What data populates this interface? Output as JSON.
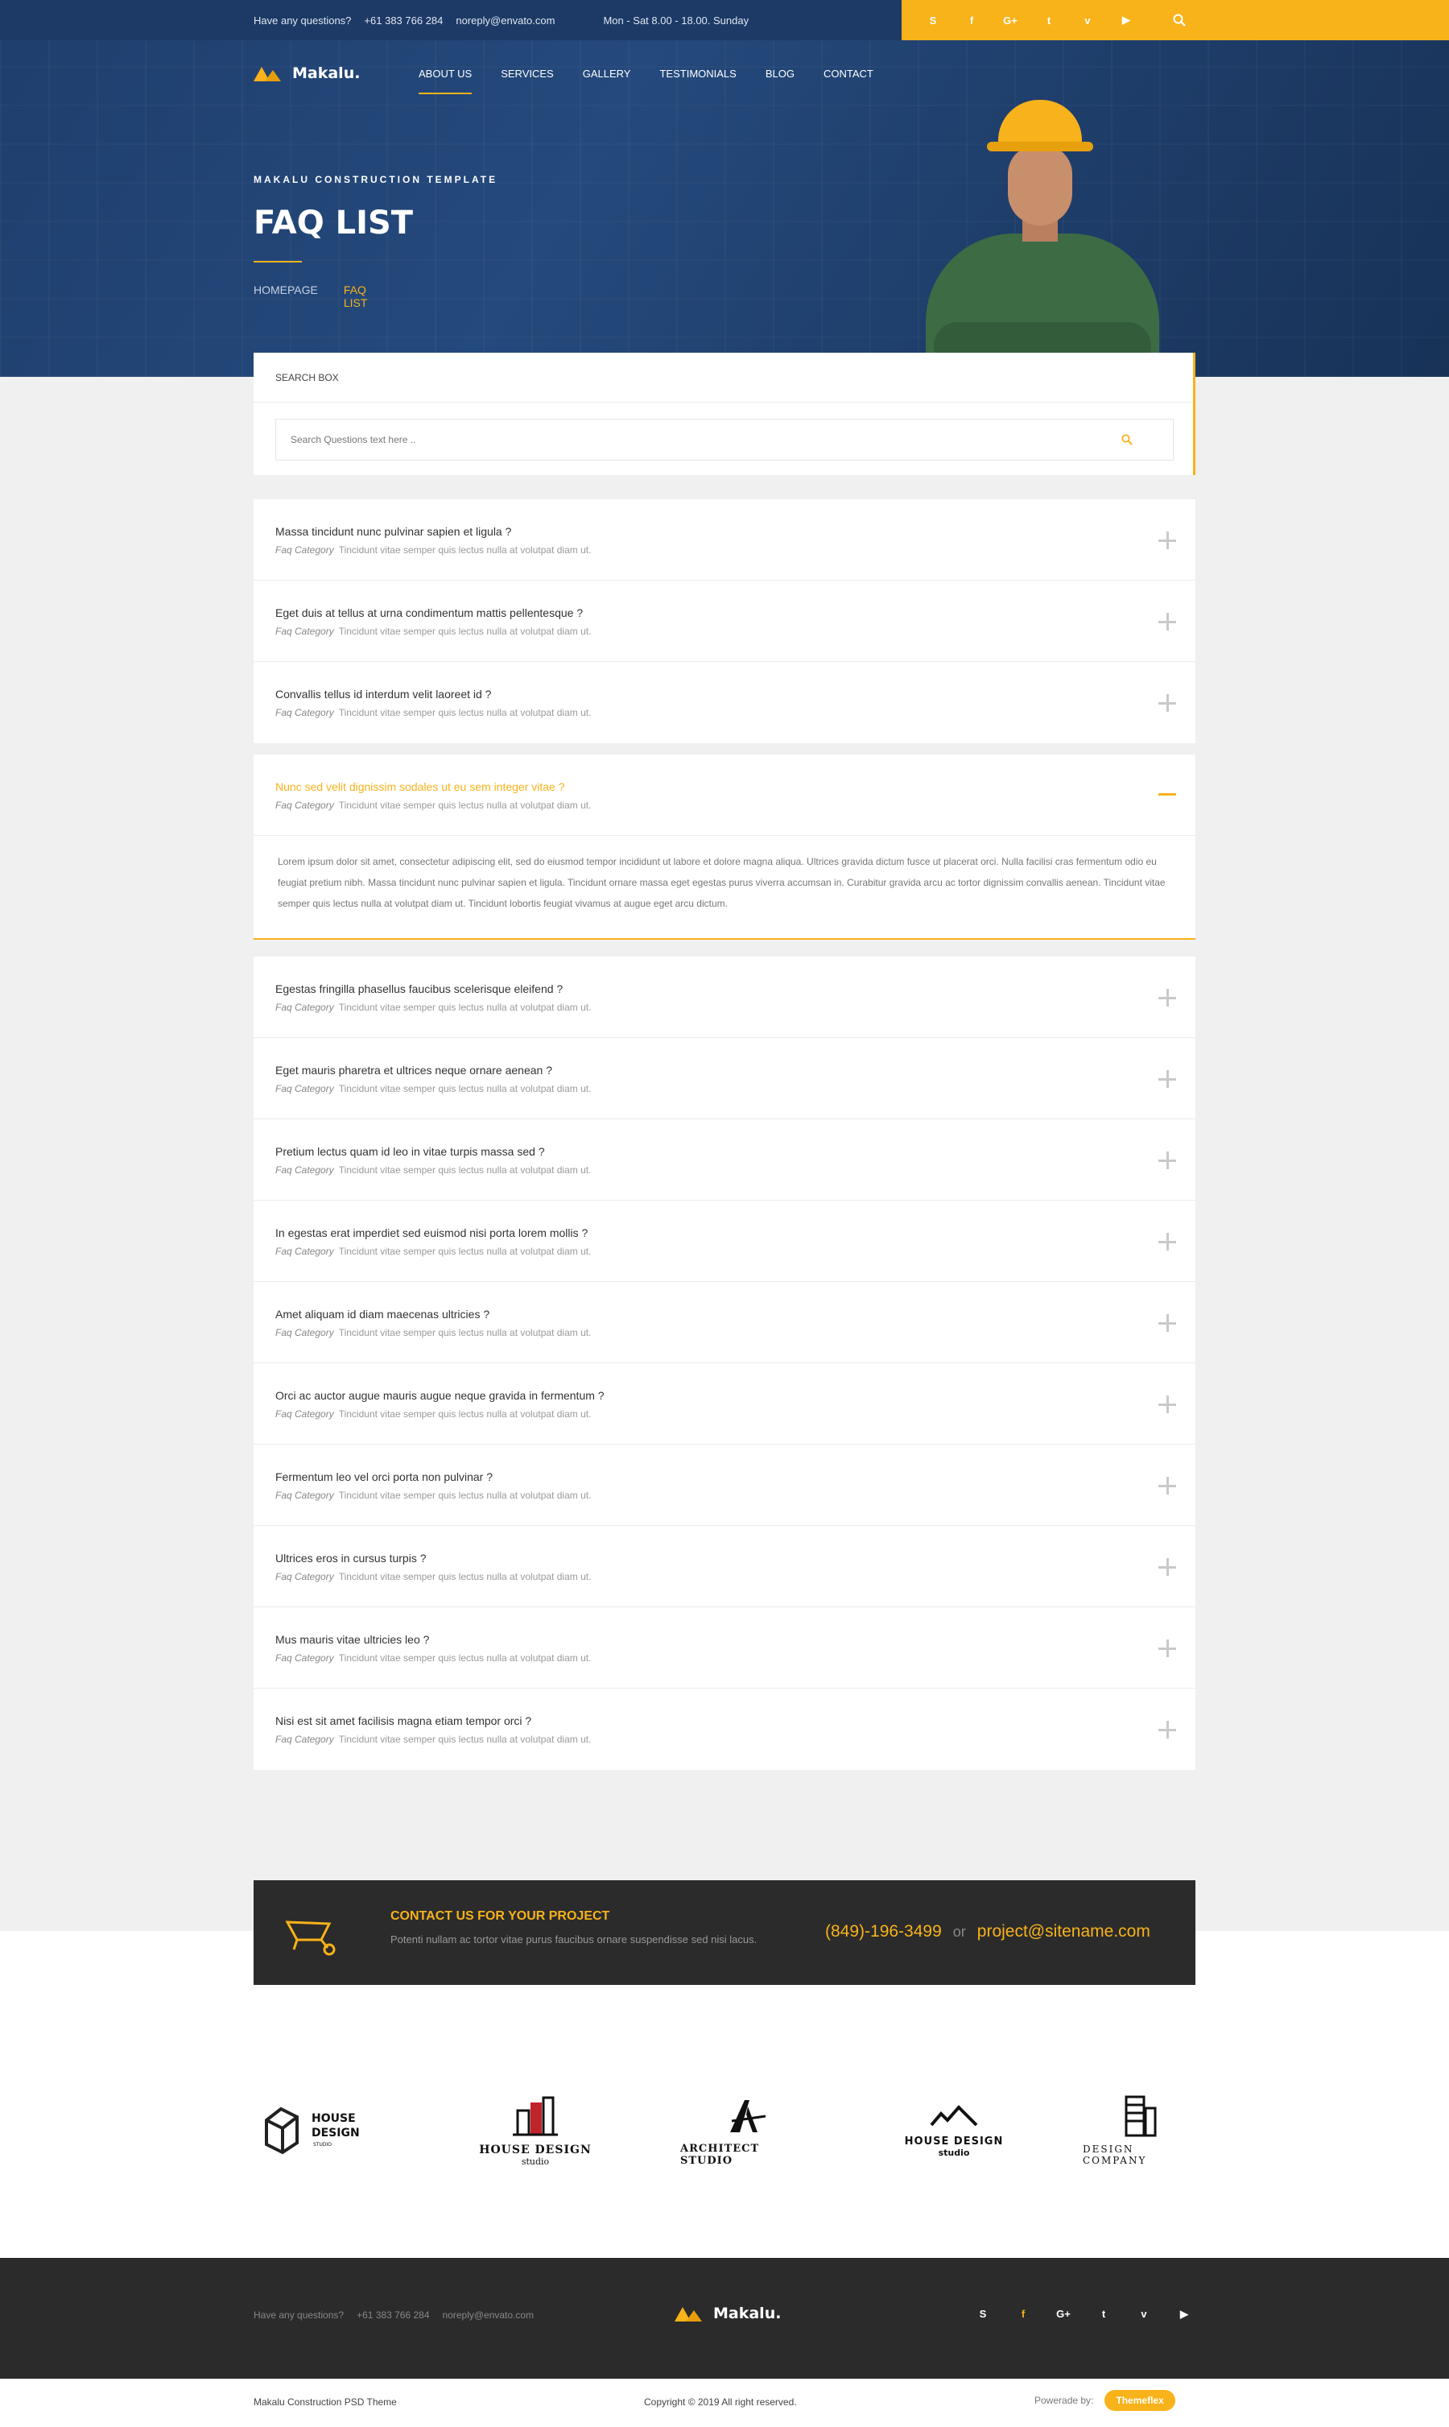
{
  "topbar": {
    "question": "Have any questions?",
    "phone": "+61 383 766 284",
    "email": "noreply@envato.com",
    "hours": "Mon - Sat 8.00 - 18.00. Sunday",
    "social_icons": [
      "skype-icon",
      "facebook-icon",
      "google-plus-icon",
      "twitter-icon",
      "vimeo-icon",
      "youtube-icon"
    ]
  },
  "brand": {
    "name": "Makalu.",
    "accent": "#f8b21a",
    "dark": "#2b2b2b",
    "navy": "#1d3a66"
  },
  "nav": [
    "ABOUT US",
    "SERVICES",
    "GALLERY",
    "TESTIMONIALS",
    "BLOG",
    "CONTACT"
  ],
  "hero": {
    "kicker": "MAKALU CONSTRUCTION TEMPLATE",
    "title": "FAQ LIST",
    "crumbs": [
      "HOMEPAGE",
      "FAQ LIST"
    ]
  },
  "search": {
    "heading": "SEARCH BOX",
    "placeholder": "Search Questions text here .."
  },
  "faq": {
    "category_label": "Faq Category",
    "meta_text": "Tincidunt vitae semper quis lectus nulla at volutpat diam ut.",
    "group1": [
      "Massa tincidunt nunc pulvinar sapien et ligula ?",
      "Eget duis at tellus at urna condimentum mattis pellentesque ?",
      "Convallis tellus id interdum velit laoreet id ?"
    ],
    "open": {
      "question": "Nunc sed velit dignissim sodales ut eu sem integer vitae ?",
      "answer": "Lorem ipsum dolor sit amet, consectetur adipiscing elit, sed do eiusmod tempor incididunt ut labore et dolore magna aliqua. Ultrices gravida dictum fusce ut placerat orci. Nulla facilisi cras fermentum odio eu feugiat pretium nibh. Massa tincidunt nunc pulvinar sapien et ligula. Tincidunt ornare massa eget egestas purus viverra accumsan in. Curabitur gravida arcu ac tortor dignissim convallis aenean. Tincidunt vitae semper quis lectus nulla at volutpat diam ut. Tincidunt lobortis feugiat vivamus at augue eget arcu dictum."
    },
    "group2": [
      "Egestas fringilla phasellus faucibus scelerisque eleifend ?",
      "Eget mauris pharetra et ultrices neque ornare aenean ?",
      "Pretium lectus quam id leo in vitae turpis massa sed ?",
      "In egestas erat imperdiet sed euismod nisi porta lorem mollis ?",
      "Amet aliquam id diam maecenas ultricies ?",
      "Orci ac auctor augue mauris augue neque gravida in fermentum ?",
      "Fermentum leo vel orci porta non pulvinar ?",
      "Ultrices eros in cursus turpis ?",
      "Mus mauris vitae ultricies leo ?",
      "Nisi est sit amet facilisis magna etiam tempor orci ?"
    ]
  },
  "cta": {
    "title": "CONTACT US FOR YOUR PROJECT",
    "subtitle": "Potenti nullam ac tortor vitae purus faucibus ornare suspendisse sed nisi lacus.",
    "phone": "(849)-196-3499",
    "or": "or",
    "email": "project@sitename.com"
  },
  "partners": [
    {
      "name": "HOUSE DESIGN",
      "sub": "STUDIO"
    },
    {
      "name": "HOUSE DESIGN",
      "sub": "studio"
    },
    {
      "name": "ARCHITECT STUDIO",
      "sub": ""
    },
    {
      "name": "HOUSE DESIGN",
      "sub": "studio"
    },
    {
      "name": "DESIGN COMPANY",
      "sub": ""
    }
  ],
  "footer": {
    "question": "Have any questions?",
    "phone": "+61 383 766 284",
    "email": "noreply@envato.com",
    "theme_name": "Makalu Construction PSD Theme",
    "copyright": "Copyright © 2019 All right reserved.",
    "powered_by": "Powerade by:",
    "badge": "Themeflex"
  }
}
